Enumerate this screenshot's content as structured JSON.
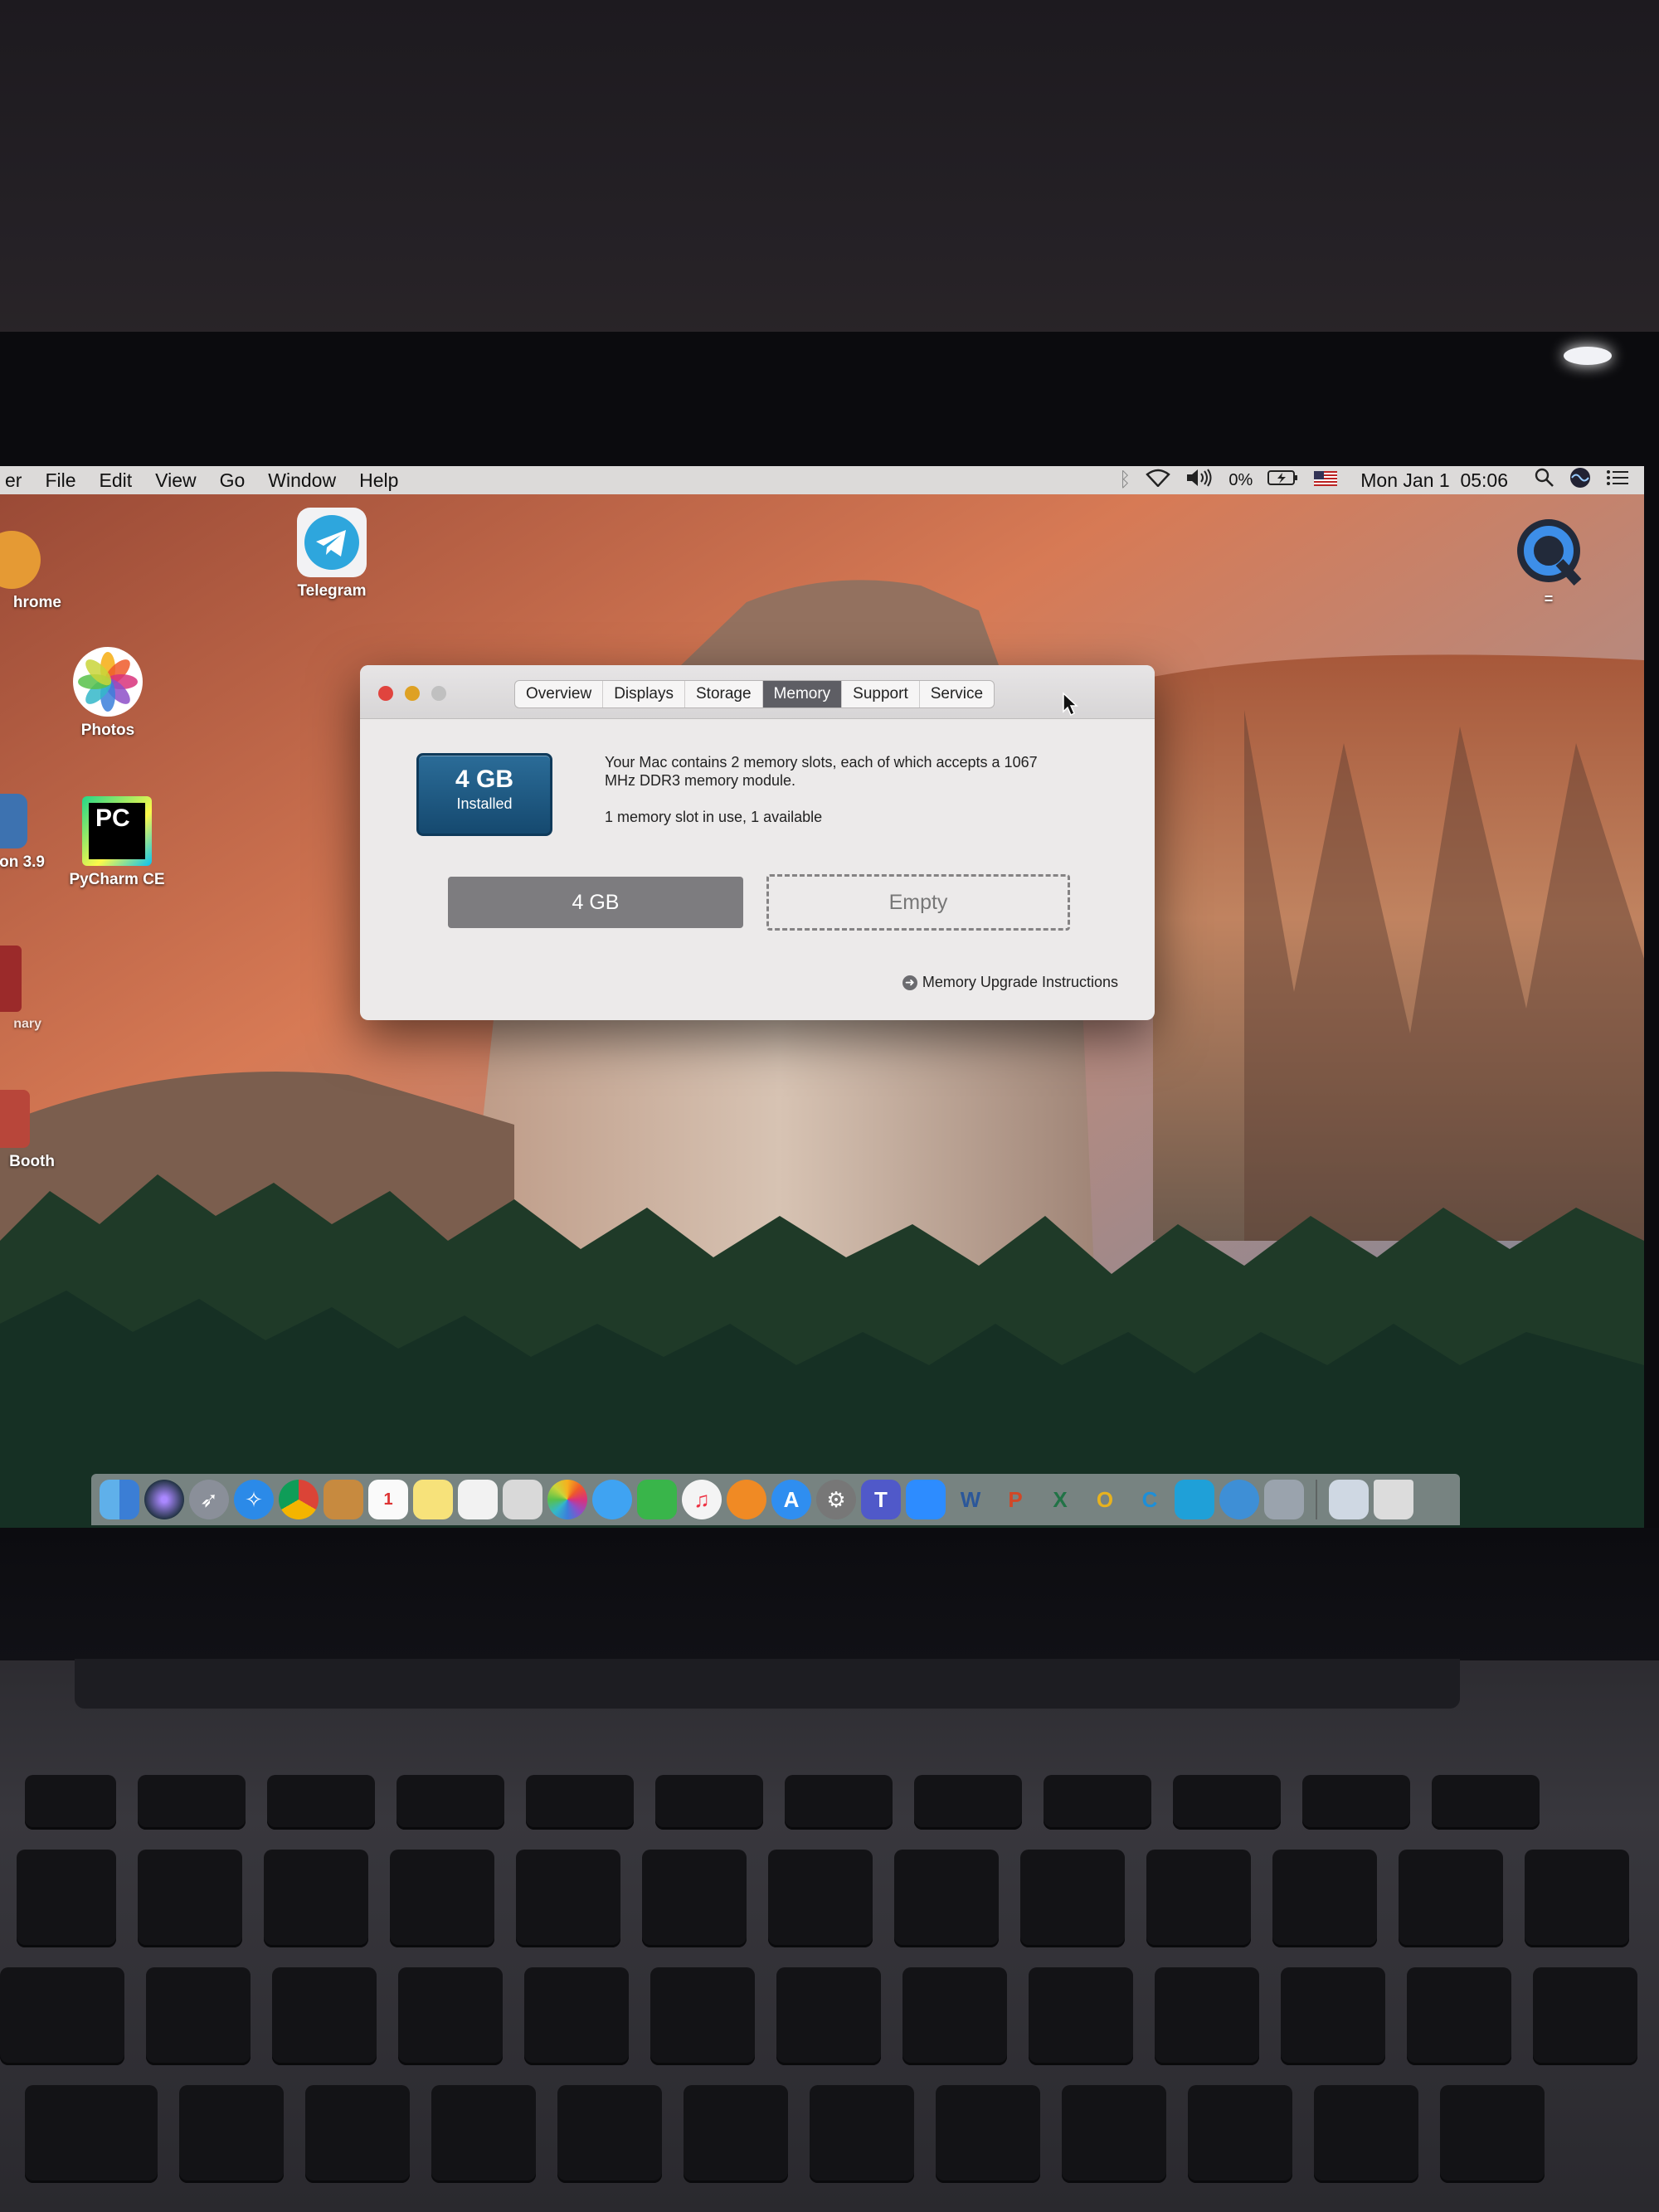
{
  "menubar": {
    "app_fragment": "er",
    "items": [
      "File",
      "Edit",
      "View",
      "Go",
      "Window",
      "Help"
    ],
    "battery": "0%",
    "clock": "Mon Jan 1  05:06"
  },
  "desktop": {
    "icons": {
      "telegram": "Telegram",
      "chrome": "hrome",
      "photos": "Photos",
      "python": "on 3.9",
      "pycharm": "PyCharm CE",
      "dictionary": "nary",
      "photobooth": "Booth"
    },
    "pycharm_glyph": "PC",
    "quicktime_label": "="
  },
  "window": {
    "tabs": [
      "Overview",
      "Displays",
      "Storage",
      "Memory",
      "Support",
      "Service"
    ],
    "active_tab": "Memory",
    "badge": {
      "amount": "4 GB",
      "caption": "Installed"
    },
    "description": "Your Mac contains 2 memory slots, each of which accepts a 1067 MHz DDR3 memory module.",
    "slot_usage": "1 memory slot in use, 1 available",
    "slots": [
      "4 GB",
      "Empty"
    ],
    "upgrade_link": "Memory Upgrade Instructions"
  },
  "colors": {
    "active_tab": "#5e5e64",
    "badge": "#1f5a86",
    "close": "#e0443e",
    "minimize": "#dea123",
    "zoom": "#c0c0c0"
  },
  "dock_icons": [
    "finder-icon",
    "siri-icon",
    "launchpad-icon",
    "safari-icon",
    "chrome-icon",
    "contacts-icon",
    "calendar-icon",
    "notes-icon",
    "reminders-icon",
    "preview-icon",
    "photos-icon",
    "messages-icon",
    "facetime-icon",
    "music-icon",
    "books-icon",
    "app-store-icon",
    "system-preferences-icon",
    "teams-icon",
    "zoom-icon",
    "word-icon",
    "powerpoint-icon",
    "excel-icon",
    "outlook-icon",
    "onenote-icon",
    "skype-icon",
    "network-icon",
    "migration-icon",
    "documents-icon",
    "trash-icon"
  ]
}
